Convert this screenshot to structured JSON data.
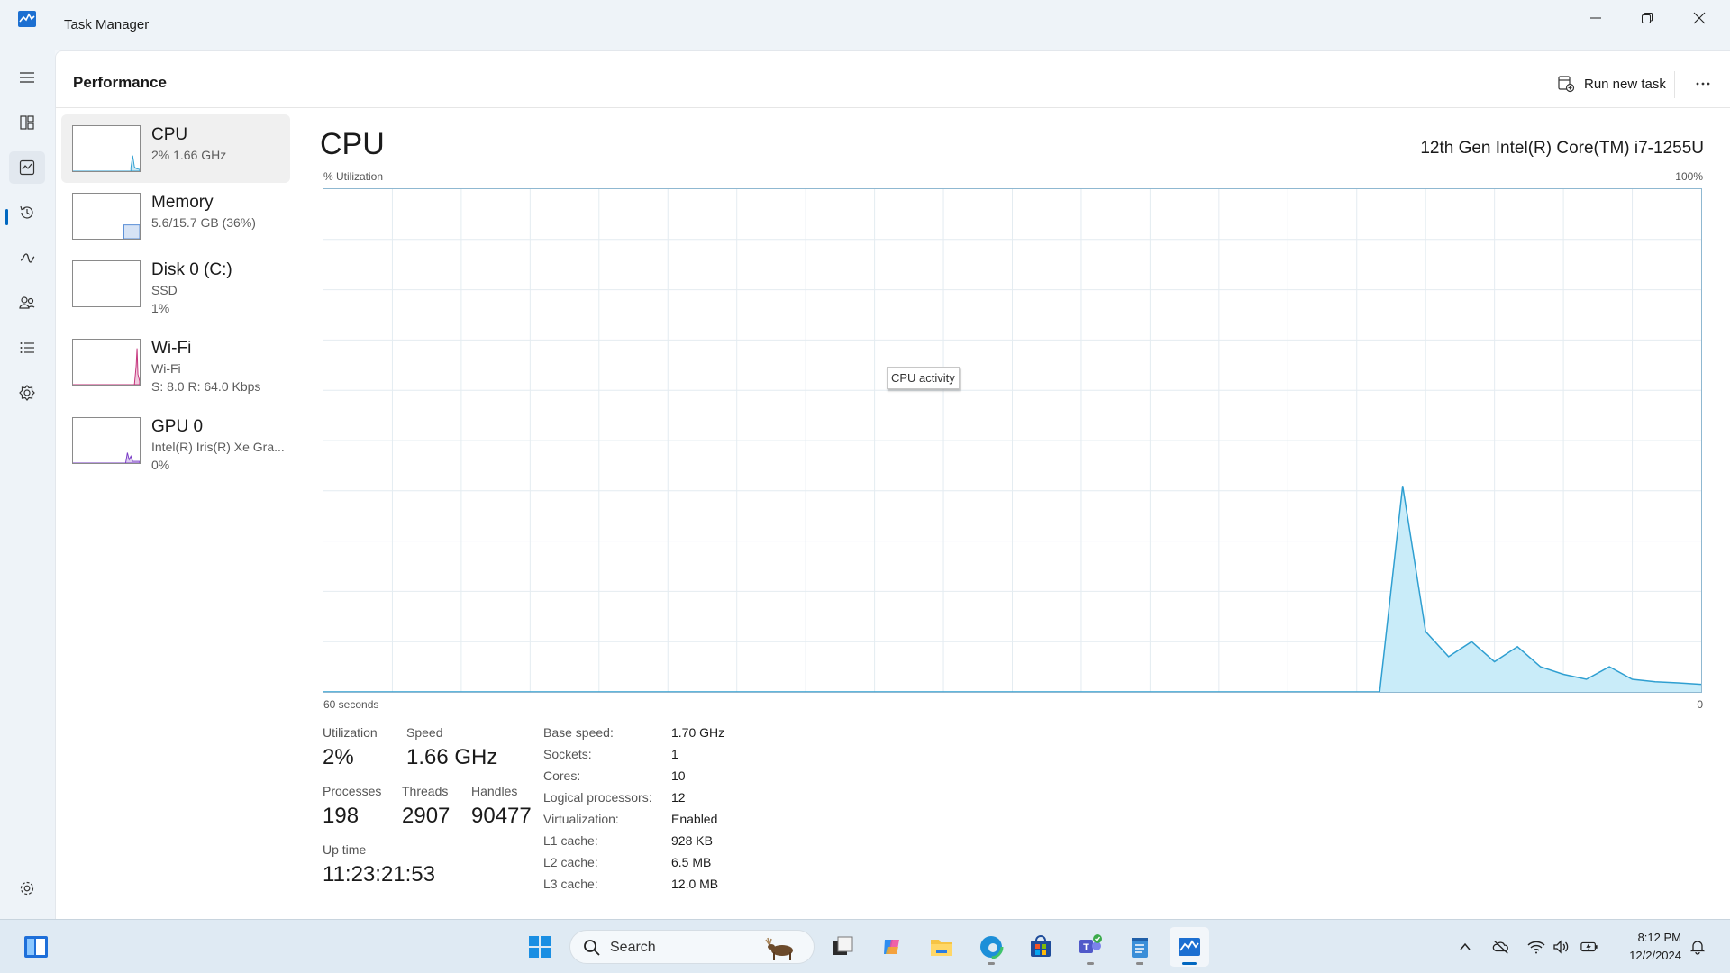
{
  "window": {
    "title": "Task Manager"
  },
  "header": {
    "page_title": "Performance",
    "run_new_task": "Run new task"
  },
  "nav": [
    {
      "name": "menu"
    },
    {
      "name": "processes"
    },
    {
      "name": "performance"
    },
    {
      "name": "app-history"
    },
    {
      "name": "startup-apps"
    },
    {
      "name": "users"
    },
    {
      "name": "details"
    },
    {
      "name": "services"
    },
    {
      "name": "settings"
    }
  ],
  "resources": [
    {
      "name": "CPU",
      "sub": [
        "2%  1.66 GHz"
      ],
      "color": "#2f9fd1",
      "selected": true
    },
    {
      "name": "Memory",
      "sub": [
        "5.6/15.7 GB (36%)"
      ],
      "color": "#5a8fd6"
    },
    {
      "name": "Disk 0 (C:)",
      "sub": [
        "SSD",
        "1%"
      ],
      "color": "#4caf50"
    },
    {
      "name": "Wi-Fi",
      "sub": [
        "Wi-Fi",
        "S: 8.0  R: 64.0 Kbps"
      ],
      "color": "#c4317a"
    },
    {
      "name": "GPU 0",
      "sub": [
        "Intel(R) Iris(R) Xe Gra...",
        "0%"
      ],
      "color": "#7a3cc6"
    }
  ],
  "cpu": {
    "title": "CPU",
    "model": "12th Gen Intel(R) Core(TM) i7-1255U",
    "y_label": "% Utilization",
    "y_max_label": "100%",
    "x_left_label": "60 seconds",
    "x_right_label": "0",
    "tooltip": "CPU activity"
  },
  "stats": {
    "utilization_label": "Utilization",
    "utilization": "2%",
    "speed_label": "Speed",
    "speed": "1.66 GHz",
    "processes_label": "Processes",
    "processes": "198",
    "threads_label": "Threads",
    "threads": "2907",
    "handles_label": "Handles",
    "handles": "90477",
    "uptime_label": "Up time",
    "uptime": "11:23:21:53"
  },
  "specs": [
    {
      "label": "Base speed:",
      "value": "1.70 GHz"
    },
    {
      "label": "Sockets:",
      "value": "1"
    },
    {
      "label": "Cores:",
      "value": "10"
    },
    {
      "label": "Logical processors:",
      "value": "12"
    },
    {
      "label": "Virtualization:",
      "value": "Enabled"
    },
    {
      "label": "L1 cache:",
      "value": "928 KB"
    },
    {
      "label": "L2 cache:",
      "value": "6.5 MB"
    },
    {
      "label": "L3 cache:",
      "value": "12.0 MB"
    }
  ],
  "chart_data": {
    "type": "area",
    "title": "CPU",
    "ylabel": "% Utilization",
    "xlabel": "60 seconds",
    "ylim": [
      0,
      100
    ],
    "xlim": [
      60,
      0
    ],
    "x": [
      60,
      14,
      13,
      12,
      11,
      10,
      9,
      8,
      7,
      6,
      5,
      4,
      3,
      2,
      1,
      0
    ],
    "values": [
      0,
      0,
      41,
      12,
      7,
      10,
      6,
      9,
      5,
      3.5,
      2.5,
      5,
      2.5,
      2,
      1.8,
      1.5
    ],
    "color": "#2f9fd1",
    "fill": "#c9ecf9"
  },
  "taskbar": {
    "search_placeholder": "Search",
    "time": "8:12 PM",
    "date": "12/2/2024",
    "apps": [
      "widgets",
      "start",
      "task-view",
      "copilot",
      "file-explorer",
      "edge",
      "store",
      "teams",
      "notepad",
      "task-manager"
    ]
  }
}
